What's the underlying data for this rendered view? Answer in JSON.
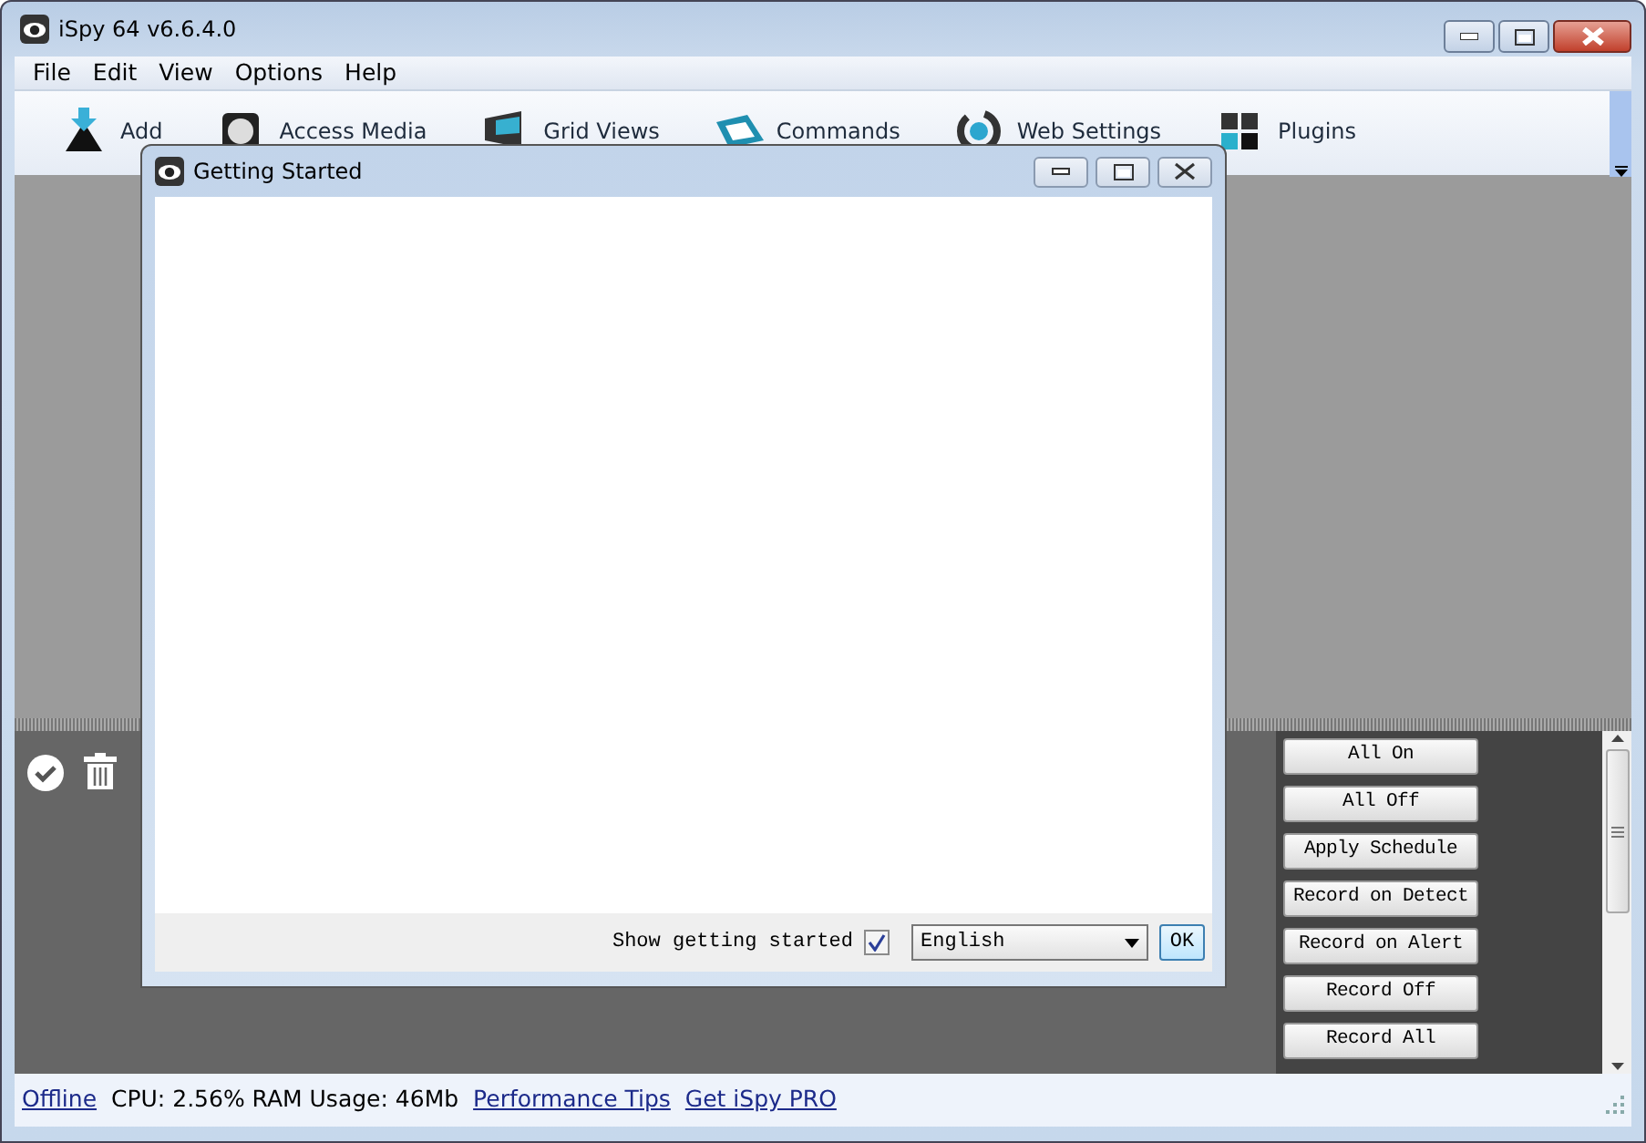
{
  "window": {
    "title": "iSpy 64 v6.6.4.0"
  },
  "menu": [
    "File",
    "Edit",
    "View",
    "Options",
    "Help"
  ],
  "toolbar": [
    {
      "label": "Add",
      "kind": "add"
    },
    {
      "label": "Access Media",
      "kind": "media"
    },
    {
      "label": "Grid Views",
      "kind": "grid"
    },
    {
      "label": "Commands",
      "kind": "commands"
    },
    {
      "label": "Web Settings",
      "kind": "web"
    },
    {
      "label": "Plugins",
      "kind": "plugins"
    }
  ],
  "dialog": {
    "title": "Getting Started",
    "show_label": "Show getting started",
    "checked": true,
    "language": "English",
    "ok": "OK"
  },
  "command_buttons": [
    "All On",
    "All Off",
    "Apply Schedule",
    "Record on Detect",
    "Record on Alert",
    "Record Off",
    "Record All"
  ],
  "status_bar": {
    "status": "Offline",
    "stats": "CPU: 2.56% RAM Usage: 46Mb",
    "links": [
      "Performance Tips",
      "Get iSpy PRO"
    ]
  }
}
